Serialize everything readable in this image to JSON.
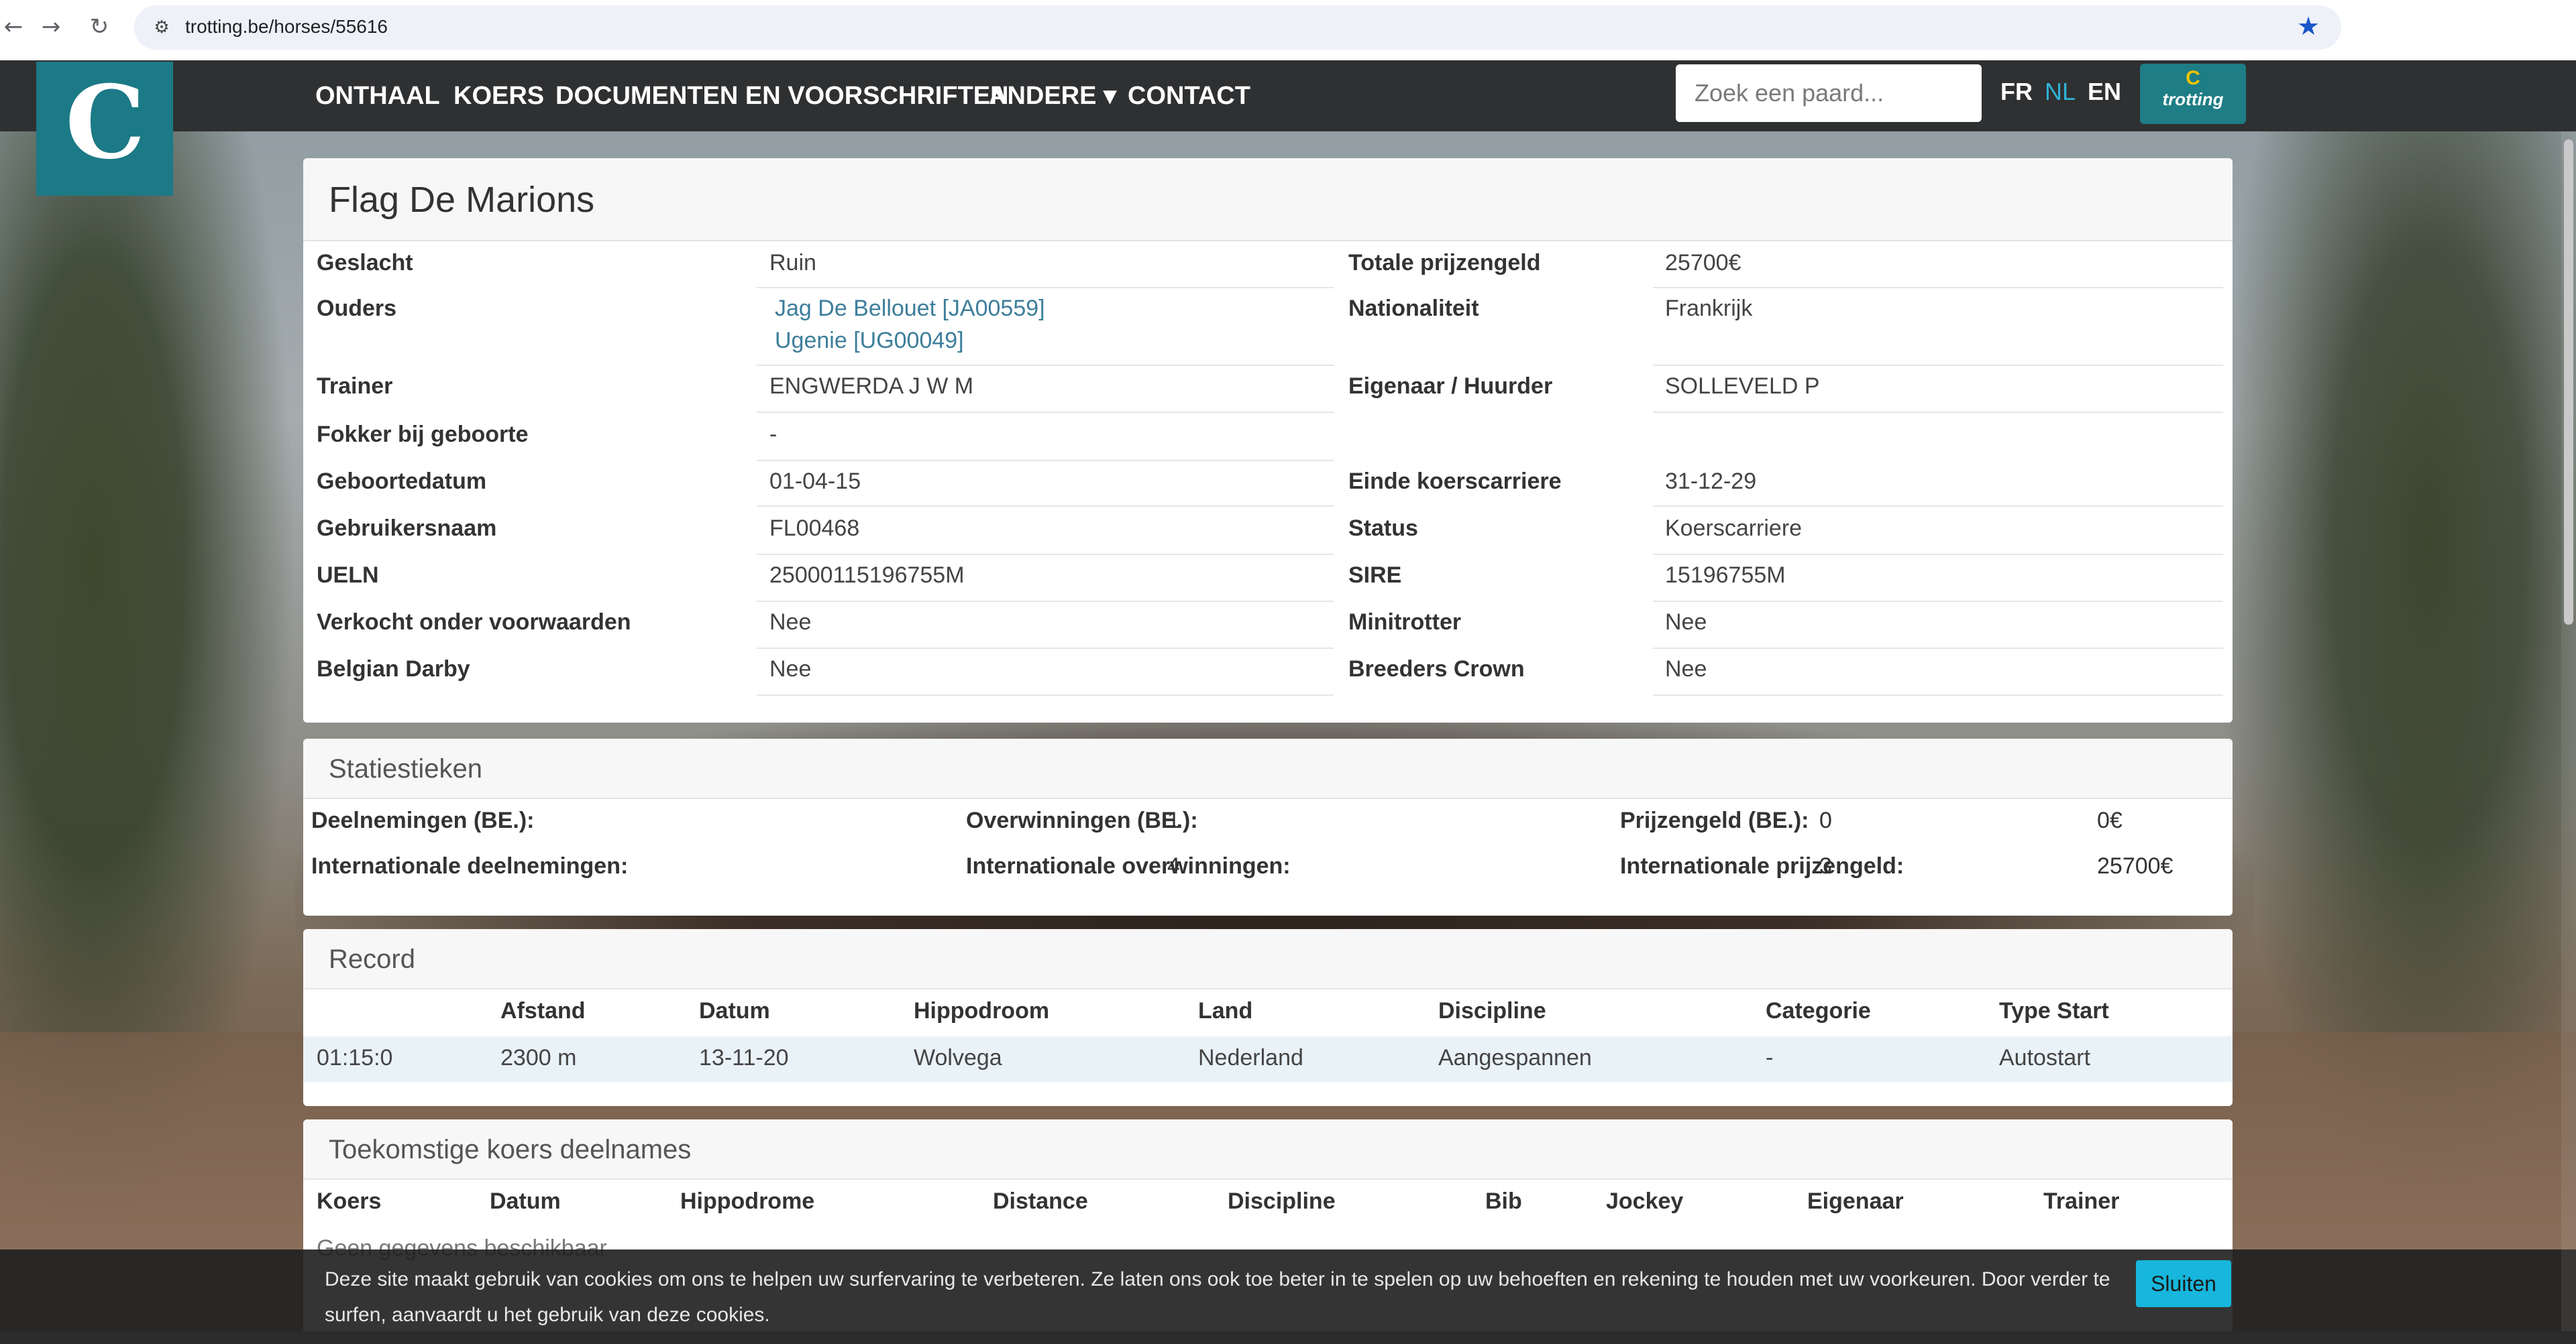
{
  "browser": {
    "url": "trotting.be/horses/55616",
    "back_icon": "←",
    "forward_icon": "→",
    "reload_icon": "↻",
    "site_info_icon": "⚙",
    "bookmark_icon": "★"
  },
  "nav": {
    "logo_glyph": "C",
    "items": [
      "ONTHAAL",
      "KOERS",
      "DOCUMENTEN EN VOORSCHRIFTEN",
      "ANDERE ▾",
      "CONTACT"
    ],
    "search_placeholder": "Zoek een paard...",
    "languages": [
      "FR",
      "NL",
      "EN"
    ],
    "active_language": "NL",
    "badge_mark": "C",
    "badge_text": "trotting"
  },
  "horse": {
    "name": "Flag De Marions",
    "details_left": [
      {
        "label": "Geslacht",
        "value": "Ruin"
      },
      {
        "label": "Ouders",
        "value": "Jag De Bellouet [JA00559]",
        "value2": "Ugenie [UG00049]"
      },
      {
        "label": "Trainer",
        "value": "ENGWERDA J W M"
      },
      {
        "label": "Fokker bij geboorte",
        "value": "-"
      },
      {
        "label": "Geboortedatum",
        "value": "01-04-15"
      },
      {
        "label": "Gebruikersnaam",
        "value": "FL00468"
      },
      {
        "label": "UELN",
        "value": "25000115196755M"
      },
      {
        "label": "Verkocht onder voorwaarden",
        "value": "Nee"
      },
      {
        "label": "Belgian Darby",
        "value": "Nee"
      }
    ],
    "details_right": [
      {
        "label": "Totale prijzengeld",
        "value": "25700€"
      },
      {
        "label": "Nationaliteit",
        "value": "Frankrijk"
      },
      {
        "label": "Eigenaar / Huurder",
        "value": "SOLLEVELD P"
      },
      {
        "label": "Einde koerscarriere",
        "value": "31-12-29"
      },
      {
        "label": "Status",
        "value": "Koerscarriere"
      },
      {
        "label": "SIRE",
        "value": "15196755M"
      },
      {
        "label": "Minitrotter",
        "value": "Nee"
      },
      {
        "label": "Breeders Crown",
        "value": "Nee"
      }
    ]
  },
  "stats": {
    "title": "Statiestieken",
    "row1": [
      {
        "label": "Deelnemingen (BE.):",
        "value": "1"
      },
      {
        "label": "Overwinningen (BE.):",
        "value": "0"
      },
      {
        "label": "Prijzengeld (BE.):",
        "value": "0€"
      }
    ],
    "row2": [
      {
        "label": "Internationale deelnemingen:",
        "value": "4"
      },
      {
        "label": "Internationale overwinningen:",
        "value": "3"
      },
      {
        "label": "Internationale prijzengeld:",
        "value": "25700€"
      }
    ]
  },
  "record": {
    "title": "Record",
    "headers": [
      "",
      "Afstand",
      "Datum",
      "Hippodroom",
      "Land",
      "Discipline",
      "Categorie",
      "Type Start"
    ],
    "row": [
      "01:15:0",
      "2300 m",
      "13-11-20",
      "Wolvega",
      "Nederland",
      "Aangespannen",
      "-",
      "Autostart"
    ]
  },
  "future": {
    "title": "Toekomstige koers deelnames",
    "headers": [
      "Koers",
      "Datum",
      "Hippodrome",
      "Distance",
      "Discipline",
      "Bib",
      "Jockey",
      "Eigenaar",
      "Trainer"
    ],
    "empty_text": "Geen gegevens beschikbaar"
  },
  "cookie": {
    "text": "Deze site maakt gebruik van cookies om ons te helpen uw surfervaring te verbeteren. Ze laten ons ook toe beter in te spelen op uw behoeften en rekening te houden met uw voorkeuren. Door verder te surfen, aanvaardt u het gebruik van deze cookies.",
    "button": "Sluiten"
  }
}
